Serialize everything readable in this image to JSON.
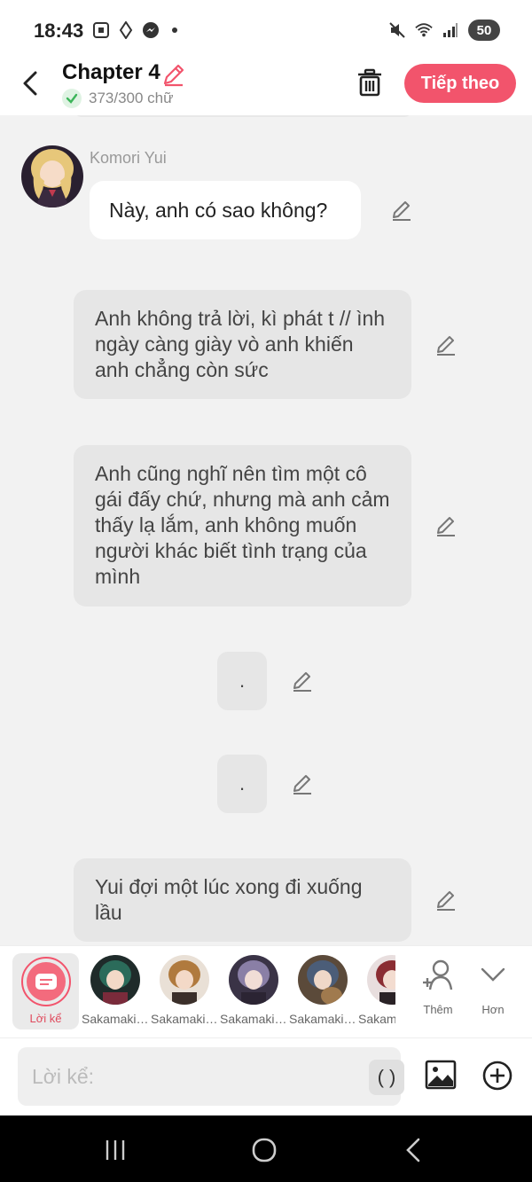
{
  "status_bar": {
    "time": "18:43",
    "battery": "50"
  },
  "header": {
    "title": "Chapter 4",
    "word_count": "373/300 chữ",
    "next_label": "Tiếp theo"
  },
  "chat": {
    "speaker_name": "Komori Yui",
    "speaker_message": "Này, anh có sao không?",
    "narrations": [
      "Anh không trả lời, kì phát t // ình ngày càng giày vò anh khiến anh chẳng còn sức",
      "Anh cũng nghĩ nên tìm một cô gái đấy chứ, nhưng mà anh cảm thấy lạ lắm, anh không muốn người khác biết tình trạng của mình",
      ".",
      ".",
      "Yui đợi một lúc xong đi xuống lầu"
    ]
  },
  "character_bar": {
    "narrator_label": "Lời kể",
    "characters": [
      {
        "label": "Sakamaki ...",
        "color": "#2b6b5a"
      },
      {
        "label": "Sakamaki ...",
        "color": "#b07a3e"
      },
      {
        "label": "Sakamaki ...",
        "color": "#8a7fa6"
      },
      {
        "label": "Sakamaki ...",
        "color": "#4b5d78"
      },
      {
        "label": "Sakamaki ...",
        "color": "#8b2d33"
      }
    ],
    "add_label": "Thêm",
    "more_label": "Hơn"
  },
  "input": {
    "placeholder": "Lời kể:",
    "paren_label": "( )"
  },
  "colors": {
    "accent": "#f2546c",
    "bubble": "#e6e6e6",
    "background": "#f2f2f2"
  }
}
